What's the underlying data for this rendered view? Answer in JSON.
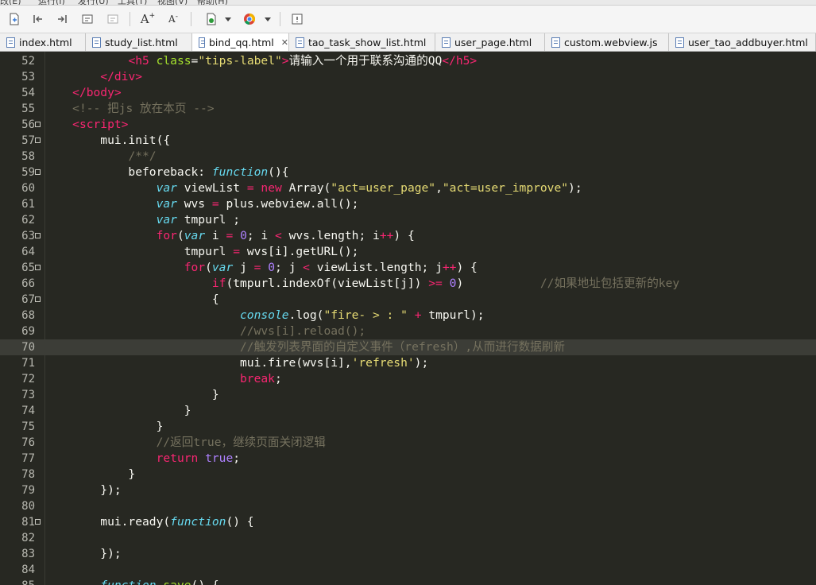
{
  "menu_fragments": [
    "改(E)",
    "运行(I)",
    "发行(U)",
    "工具(T)",
    "视图(V)",
    "帮助(H)"
  ],
  "tabs": [
    {
      "label": "index.html",
      "active": false,
      "icon": "html-file-icon"
    },
    {
      "label": "study_list.html",
      "active": false,
      "icon": "html-file-icon"
    },
    {
      "label": "bind_qq.html",
      "active": true,
      "icon": "html-file-icon",
      "close": "✕"
    },
    {
      "label": "tao_task_show_list.html",
      "active": false,
      "icon": "html-file-icon"
    },
    {
      "label": "user_page.html",
      "active": false,
      "icon": "html-file-icon"
    },
    {
      "label": "custom.webview.js",
      "active": false,
      "icon": "js-file-icon"
    },
    {
      "label": "user_tao_addbuyer.html",
      "active": false,
      "icon": "html-file-icon"
    }
  ],
  "toolbar": {
    "font_increase": "A",
    "font_decrease": "A"
  },
  "current_line": "70",
  "lines": [
    {
      "n": "52",
      "fold": false,
      "tokens": [
        [
          "pl",
          "            "
        ],
        [
          "tag",
          "<h5"
        ],
        [
          "pl",
          " "
        ],
        [
          "attr",
          "class"
        ],
        [
          "pl",
          "="
        ],
        [
          "str",
          "\"tips-label\""
        ],
        [
          "tag",
          ">"
        ],
        [
          "pl",
          "请输入一个用于联系沟通的QQ"
        ],
        [
          "tag",
          "</h5>"
        ]
      ]
    },
    {
      "n": "53",
      "fold": false,
      "tokens": [
        [
          "pl",
          "        "
        ],
        [
          "tag",
          "</div>"
        ]
      ]
    },
    {
      "n": "54",
      "fold": false,
      "tokens": [
        [
          "pl",
          "    "
        ],
        [
          "tag",
          "</body>"
        ]
      ]
    },
    {
      "n": "55",
      "fold": false,
      "tokens": [
        [
          "pl",
          "    "
        ],
        [
          "cmt",
          "<!-- 把js 放在本页 -->"
        ]
      ]
    },
    {
      "n": "56",
      "fold": true,
      "tokens": [
        [
          "pl",
          "    "
        ],
        [
          "tag",
          "<script>"
        ]
      ]
    },
    {
      "n": "57",
      "fold": true,
      "tokens": [
        [
          "pl",
          "        mui.init({"
        ]
      ]
    },
    {
      "n": "58",
      "fold": false,
      "tokens": [
        [
          "pl",
          "            "
        ],
        [
          "cmt",
          "/**/"
        ]
      ]
    },
    {
      "n": "59",
      "fold": true,
      "tokens": [
        [
          "pl",
          "            beforeback: "
        ],
        [
          "kw",
          "function"
        ],
        [
          "pl",
          "(){"
        ]
      ]
    },
    {
      "n": "60",
      "fold": false,
      "tokens": [
        [
          "pl",
          "                "
        ],
        [
          "kw",
          "var"
        ],
        [
          "pl",
          " viewList "
        ],
        [
          "op",
          "="
        ],
        [
          "pl",
          " "
        ],
        [
          "ctl",
          "new"
        ],
        [
          "pl",
          " Array("
        ],
        [
          "str",
          "\"act=user_page\""
        ],
        [
          "pl",
          ","
        ],
        [
          "str",
          "\"act=user_improve\""
        ],
        [
          "pl",
          ");"
        ]
      ]
    },
    {
      "n": "61",
      "fold": false,
      "tokens": [
        [
          "pl",
          "                "
        ],
        [
          "kw",
          "var"
        ],
        [
          "pl",
          " wvs "
        ],
        [
          "op",
          "="
        ],
        [
          "pl",
          " plus.webview.all();"
        ]
      ]
    },
    {
      "n": "62",
      "fold": false,
      "tokens": [
        [
          "pl",
          "                "
        ],
        [
          "kw",
          "var"
        ],
        [
          "pl",
          " tmpurl ;"
        ]
      ]
    },
    {
      "n": "63",
      "fold": true,
      "tokens": [
        [
          "pl",
          "                "
        ],
        [
          "ctl",
          "for"
        ],
        [
          "pl",
          "("
        ],
        [
          "kw",
          "var"
        ],
        [
          "pl",
          " i "
        ],
        [
          "op",
          "="
        ],
        [
          "pl",
          " "
        ],
        [
          "num",
          "0"
        ],
        [
          "pl",
          "; i "
        ],
        [
          "op",
          "<"
        ],
        [
          "pl",
          " wvs.length; i"
        ],
        [
          "op",
          "++"
        ],
        [
          "pl",
          ") {"
        ]
      ]
    },
    {
      "n": "64",
      "fold": false,
      "tokens": [
        [
          "pl",
          "                    tmpurl "
        ],
        [
          "op",
          "="
        ],
        [
          "pl",
          " wvs[i].getURL();"
        ]
      ]
    },
    {
      "n": "65",
      "fold": true,
      "tokens": [
        [
          "pl",
          "                    "
        ],
        [
          "ctl",
          "for"
        ],
        [
          "pl",
          "("
        ],
        [
          "kw",
          "var"
        ],
        [
          "pl",
          " j "
        ],
        [
          "op",
          "="
        ],
        [
          "pl",
          " "
        ],
        [
          "num",
          "0"
        ],
        [
          "pl",
          "; j "
        ],
        [
          "op",
          "<"
        ],
        [
          "pl",
          " viewList.length; j"
        ],
        [
          "op",
          "++"
        ],
        [
          "pl",
          ") {"
        ]
      ]
    },
    {
      "n": "66",
      "fold": false,
      "tokens": [
        [
          "pl",
          "                        "
        ],
        [
          "ctl",
          "if"
        ],
        [
          "pl",
          "(tmpurl.indexOf(viewList[j]) "
        ],
        [
          "op",
          ">="
        ],
        [
          "pl",
          " "
        ],
        [
          "num",
          "0"
        ],
        [
          "pl",
          ")           "
        ],
        [
          "cmt",
          "//如果地址包括更新的key"
        ]
      ]
    },
    {
      "n": "67",
      "fold": true,
      "tokens": [
        [
          "pl",
          "                        {"
        ]
      ]
    },
    {
      "n": "68",
      "fold": false,
      "tokens": [
        [
          "pl",
          "                            "
        ],
        [
          "kw",
          "console"
        ],
        [
          "pl",
          ".log("
        ],
        [
          "str",
          "\"fire- > : \""
        ],
        [
          "pl",
          " "
        ],
        [
          "op",
          "+"
        ],
        [
          "pl",
          " tmpurl);"
        ]
      ]
    },
    {
      "n": "69",
      "fold": false,
      "tokens": [
        [
          "pl",
          "                            "
        ],
        [
          "cmt",
          "//wvs[i].reload();"
        ]
      ]
    },
    {
      "n": "70",
      "fold": false,
      "tokens": [
        [
          "pl",
          "                            "
        ],
        [
          "cmt",
          "//触发列表界面的自定义事件（refresh）,从而进行数据刷新"
        ]
      ]
    },
    {
      "n": "71",
      "fold": false,
      "tokens": [
        [
          "pl",
          "                            mui.fire(wvs[i],"
        ],
        [
          "str",
          "'refresh'"
        ],
        [
          "pl",
          ");"
        ]
      ]
    },
    {
      "n": "72",
      "fold": false,
      "tokens": [
        [
          "pl",
          "                            "
        ],
        [
          "ctl",
          "break"
        ],
        [
          "pl",
          ";"
        ]
      ]
    },
    {
      "n": "73",
      "fold": false,
      "tokens": [
        [
          "pl",
          "                        }"
        ]
      ]
    },
    {
      "n": "74",
      "fold": false,
      "tokens": [
        [
          "pl",
          "                    }"
        ]
      ]
    },
    {
      "n": "75",
      "fold": false,
      "tokens": [
        [
          "pl",
          "                }"
        ]
      ]
    },
    {
      "n": "76",
      "fold": false,
      "tokens": [
        [
          "pl",
          "                "
        ],
        [
          "cmt",
          "//返回true，继续页面关闭逻辑"
        ]
      ]
    },
    {
      "n": "77",
      "fold": false,
      "tokens": [
        [
          "pl",
          "                "
        ],
        [
          "ctl",
          "return"
        ],
        [
          "pl",
          " "
        ],
        [
          "const",
          "true"
        ],
        [
          "pl",
          ";"
        ]
      ]
    },
    {
      "n": "78",
      "fold": false,
      "tokens": [
        [
          "pl",
          "            }"
        ]
      ]
    },
    {
      "n": "79",
      "fold": false,
      "tokens": [
        [
          "pl",
          "        });"
        ]
      ]
    },
    {
      "n": "80",
      "fold": false,
      "tokens": []
    },
    {
      "n": "81",
      "fold": true,
      "tokens": [
        [
          "pl",
          "        mui.ready("
        ],
        [
          "kw",
          "function"
        ],
        [
          "pl",
          "() {"
        ]
      ]
    },
    {
      "n": "82",
      "fold": false,
      "tokens": []
    },
    {
      "n": "83",
      "fold": false,
      "tokens": [
        [
          "pl",
          "        });"
        ]
      ]
    },
    {
      "n": "84",
      "fold": false,
      "tokens": []
    },
    {
      "n": "85",
      "fold": false,
      "tokens": [
        [
          "pl",
          "        "
        ],
        [
          "kw",
          "function"
        ],
        [
          "pl",
          " "
        ],
        [
          "fn",
          "save"
        ],
        [
          "pl",
          "() {"
        ]
      ]
    }
  ],
  "colors": {
    "editor_bg": "#272822",
    "tag": "#f92672",
    "attr": "#a6e22e",
    "string": "#e6db74",
    "comment": "#75715e",
    "keyword": "#66d9ef",
    "number": "#ae81ff"
  }
}
